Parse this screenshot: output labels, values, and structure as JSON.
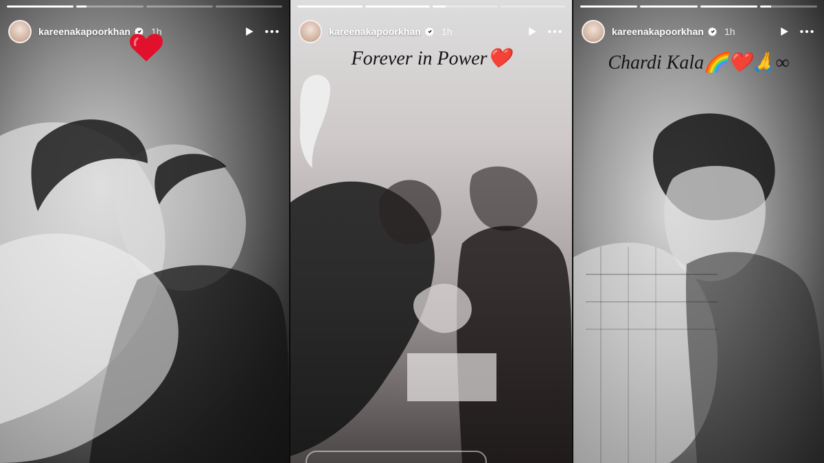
{
  "stories": [
    {
      "username": "kareenakapoorkhan",
      "time": "1h",
      "caption": "",
      "progress": [
        1.0,
        0.15,
        0.0,
        0.0
      ]
    },
    {
      "username": "kareenakapoorkhan",
      "time": "1h",
      "caption": "Forever in Power❤️",
      "progress": [
        1.0,
        1.0,
        0.2,
        0.0
      ]
    },
    {
      "username": "kareenakapoorkhan",
      "time": "1h",
      "caption": "Chardi Kala🌈❤️🙏∞",
      "progress": [
        1.0,
        1.0,
        1.0,
        0.2
      ]
    }
  ],
  "icons": {
    "play": "play-icon",
    "more": "more-icon",
    "verified": "verified-badge-icon",
    "heart": "heart-sticker"
  },
  "colors": {
    "ig_blue": "#3b82f6",
    "heart": "#e1102b"
  }
}
